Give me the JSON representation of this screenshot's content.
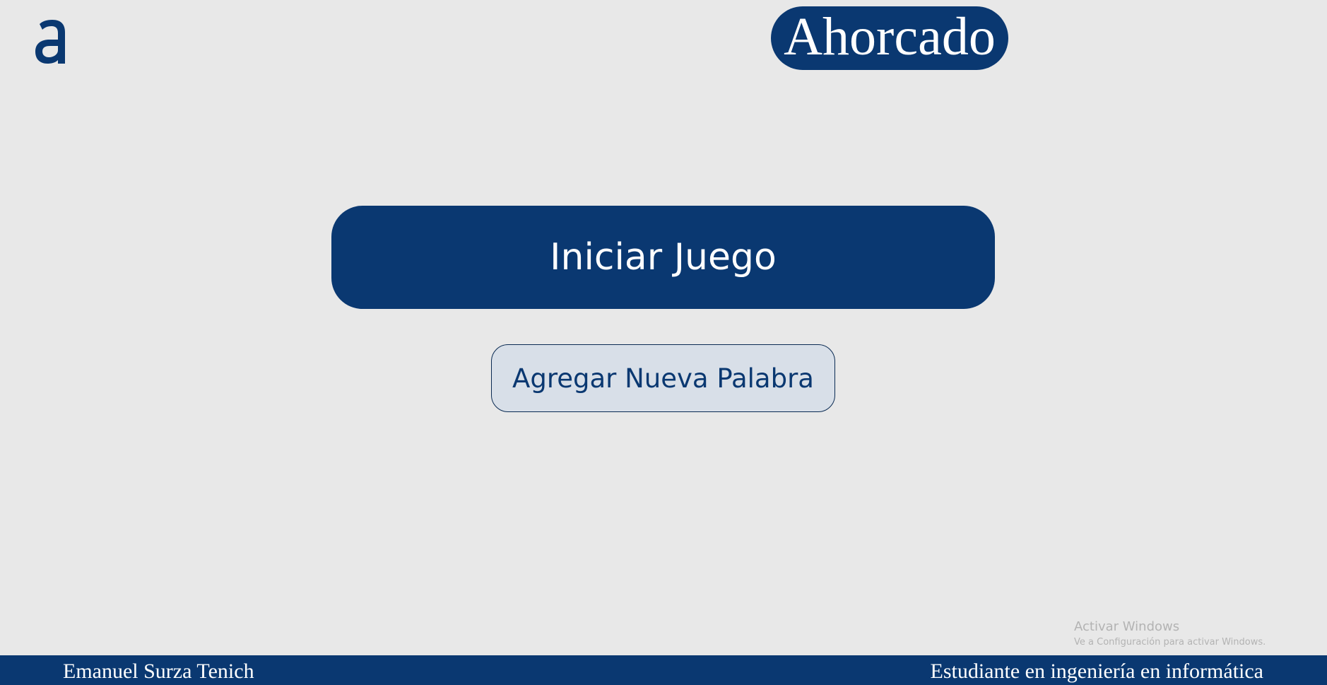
{
  "header": {
    "logo_icon": "alura-a-logo-icon",
    "title": "Ahorcado"
  },
  "main": {
    "start_button_label": "Iniciar Juego",
    "add_word_button_label": "Agregar Nueva Palabra"
  },
  "watermark": {
    "title": "Activar Windows",
    "subtitle": "Ve a Configuración para activar Windows."
  },
  "footer": {
    "author": "Emanuel Surza Tenich",
    "role": "Estudiante en ingeniería en informática"
  },
  "colors": {
    "brand": "#0a3871",
    "background": "#e8e8e8",
    "secondary_button_bg": "#d8dfe8"
  }
}
